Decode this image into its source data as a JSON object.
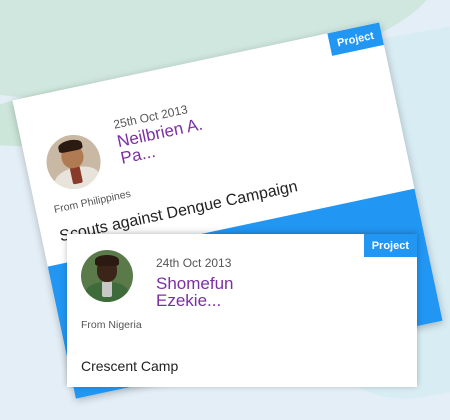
{
  "cards": [
    {
      "badge": "Project",
      "date": "25th Oct 2013",
      "name": "Neilbrien A. Pa...",
      "from": "From Philippines",
      "title": "Scouts against Dengue Campaign",
      "avatar": "avatar-photo"
    },
    {
      "badge": "Project",
      "date": "24th Oct 2013",
      "name": "Shomefun Ezekie...",
      "from": "From Nigeria",
      "title": "Crescent Camp",
      "avatar": "avatar-photo"
    }
  ],
  "colors": {
    "accent": "#2196f3",
    "name": "#7b2fa3"
  }
}
